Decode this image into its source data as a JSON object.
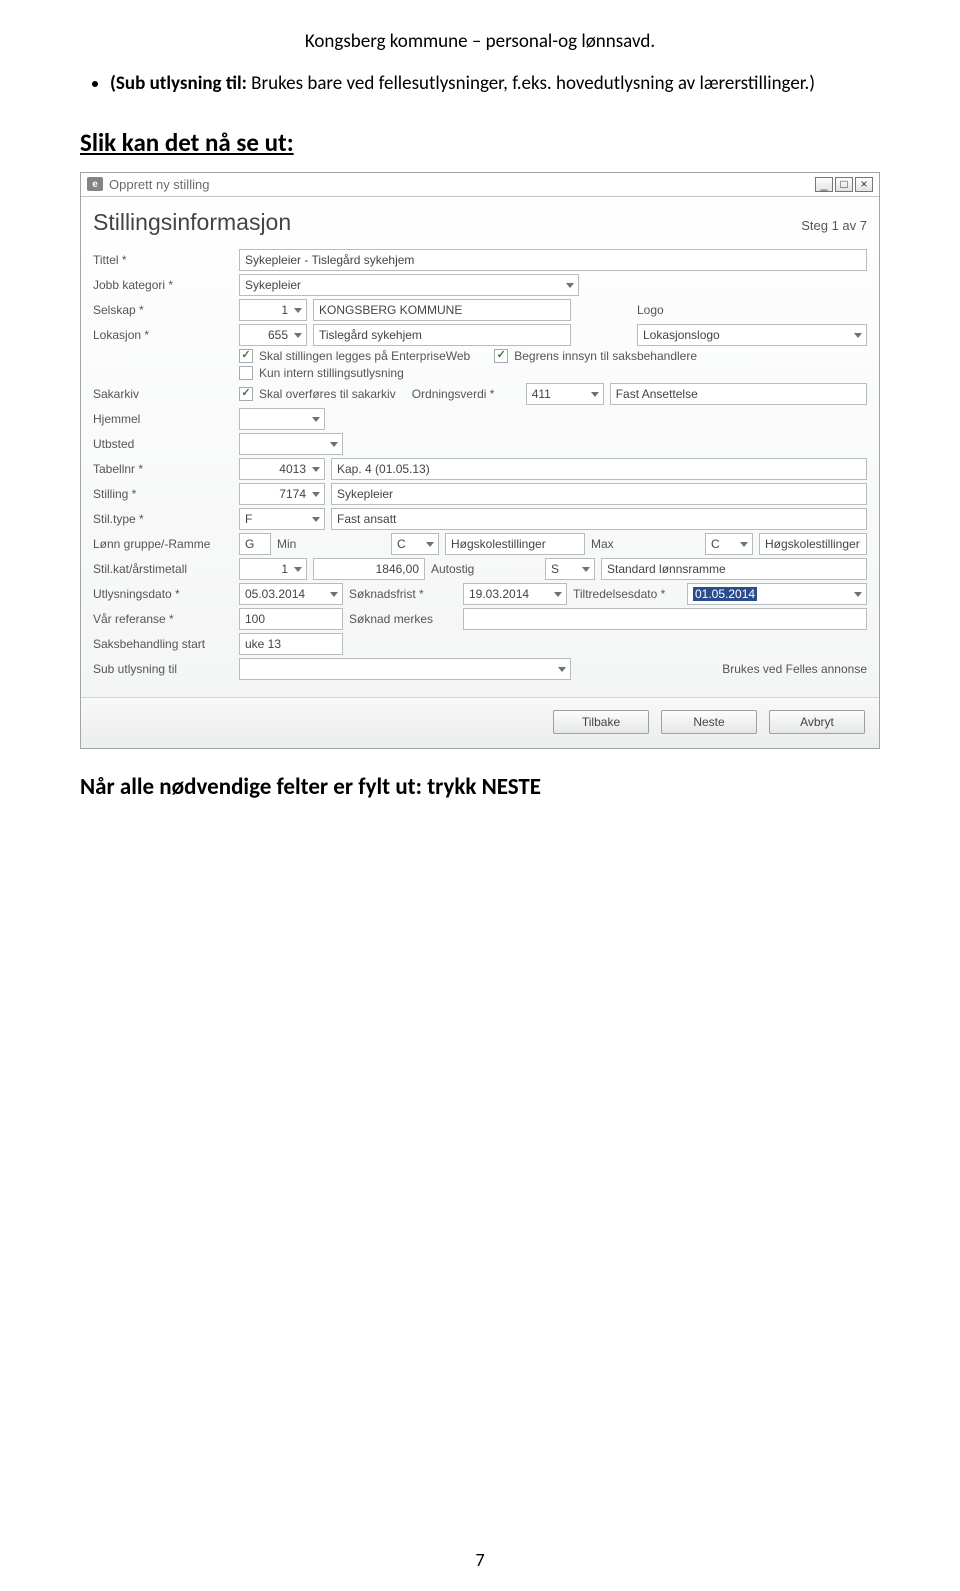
{
  "document": {
    "header": "Kongsberg kommune – personal-og lønnsavd.",
    "bullet_label": "(Sub utlysning til:",
    "bullet_rest": " Brukes bare ved fellesutlysninger, f.eks. hovedutlysning av lærerstillinger.)",
    "section_title": "Slik kan det nå se ut:",
    "follow_text": "Når alle nødvendige felter er fylt ut:  trykk NESTE",
    "page_number": "7"
  },
  "window": {
    "icon_letter": "e",
    "title": "Opprett ny stilling",
    "min": "_",
    "max": "□",
    "close": "×",
    "heading": "Stillingsinformasjon",
    "step": "Steg 1 av 7",
    "buttons": {
      "back": "Tilbake",
      "next": "Neste",
      "cancel": "Avbryt"
    }
  },
  "form": {
    "tittel_lab": "Tittel *",
    "tittel_val": "Sykepleier - Tislegård sykehjem",
    "jobbkat_lab": "Jobb kategori *",
    "jobbkat_val": "Sykepleier",
    "selskap_lab": "Selskap *",
    "selskap_code": "1",
    "selskap_val": "KONGSBERG KOMMUNE",
    "logo_lab": "Logo",
    "lokasjon_lab": "Lokasjon *",
    "lokasjon_code": "655",
    "lokasjon_val": "Tislegård sykehjem",
    "lokasjonslogo_lab": "Lokasjonslogo",
    "cb_enterprise": "Skal stillingen legges på EnterpriseWeb",
    "cb_begrens": "Begrens innsyn til saksbehandlere",
    "cb_intern": "Kun intern stillingsutlysning",
    "sakarkiv_lab": "Sakarkiv",
    "cb_overfores": "Skal overføres til sakarkiv",
    "ordningsverdi_lab": "Ordningsverdi *",
    "ordningsverdi_val": "411",
    "ordningsverdi_desc": "Fast Ansettelse",
    "hjemmel_lab": "Hjemmel",
    "utbsted_lab": "Utbsted",
    "tabellnr_lab": "Tabellnr *",
    "tabellnr_val": "4013",
    "tabellnr_desc": "Kap. 4 (01.05.13)",
    "stilling_lab": "Stilling *",
    "stilling_val": "7174",
    "stilling_desc": "Sykepleier",
    "stiltype_lab": "Stil.type *",
    "stiltype_val": "F",
    "stiltype_desc": "Fast ansatt",
    "lonngr_lab": "Lønn gruppe/-Ramme",
    "lonngr_val": "G",
    "min_lab": "Min",
    "min_val": "C",
    "min_desc": "Høgskolestillinger",
    "max_lab": "Max",
    "max_val": "C",
    "max_desc": "Høgskolestillinger",
    "stilkat_lab": "Stil.kat/årstimetall",
    "stilkat_val": "1",
    "stilkat_num": "1846,00",
    "autostig_lab": "Autostig",
    "autostig_val": "S",
    "autostig_desc": "Standard lønnsramme",
    "utlysdato_lab": "Utlysningsdato *",
    "utlysdato_val": "05.03.2014",
    "soknadsfrist_lab": "Søknadsfrist *",
    "soknadsfrist_val": "19.03.2014",
    "tiltredelse_lab": "Tiltredelsesdato *",
    "tiltredelse_val": "01.05.2014",
    "varref_lab": "Vår referanse *",
    "varref_val": "100",
    "soknadmerkes_lab": "Søknad merkes",
    "saksbeh_lab": "Saksbehandling start",
    "saksbeh_val": "uke 13",
    "subutlys_lab": "Sub utlysning til",
    "subutlys_note": "Brukes ved Felles annonse"
  }
}
